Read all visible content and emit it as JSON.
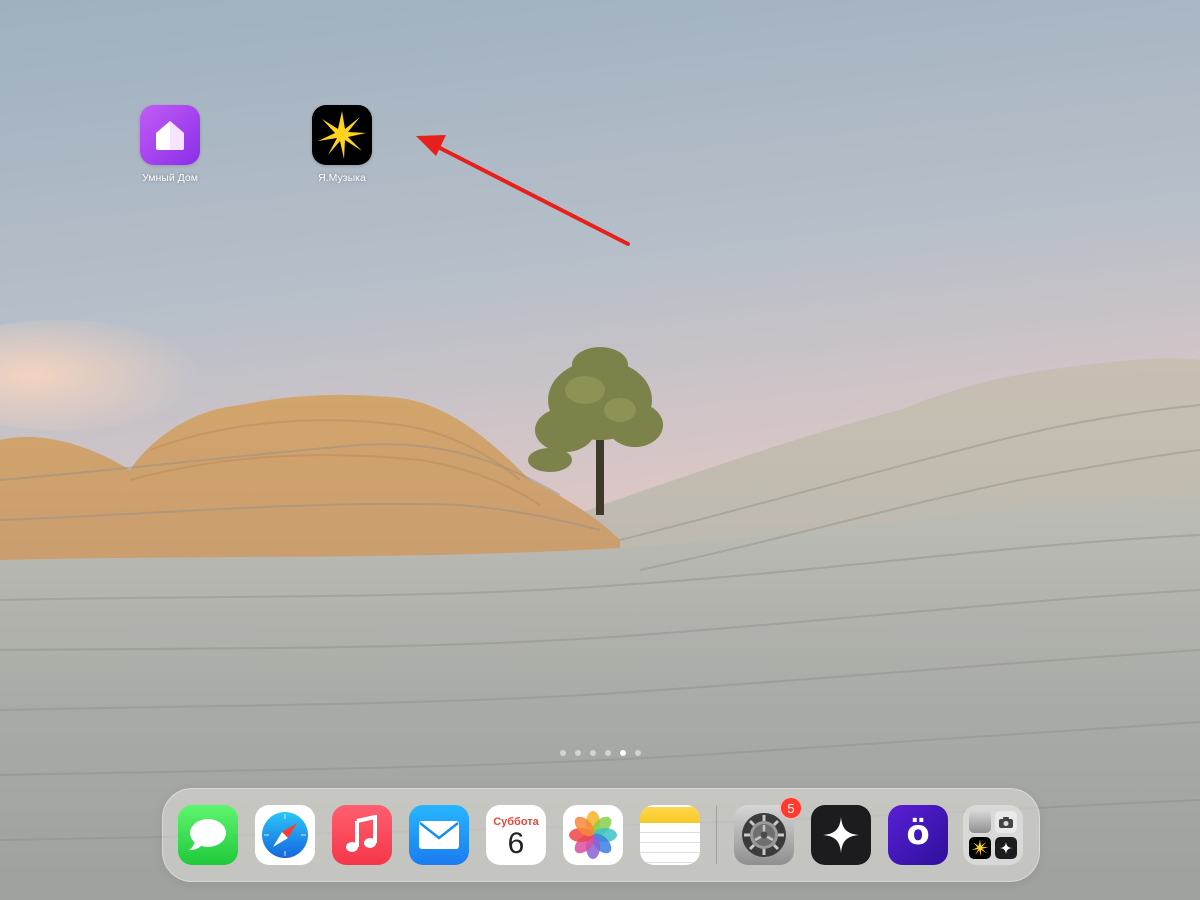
{
  "home_screen": {
    "apps": [
      {
        "label": "Умный Дом",
        "icon": "smart-home-icon",
        "color": "#a53ef0"
      },
      {
        "label": "Я.Музыка",
        "icon": "yandex-music-icon",
        "color": "#000000"
      }
    ]
  },
  "annotation": {
    "color": "#e8201c"
  },
  "page_indicator": {
    "pages": 6,
    "current": 5
  },
  "dock": {
    "apps": [
      {
        "name": "messages",
        "icon": "messages-icon"
      },
      {
        "name": "safari",
        "icon": "safari-icon"
      },
      {
        "name": "music",
        "icon": "music-icon"
      },
      {
        "name": "mail",
        "icon": "mail-icon"
      },
      {
        "name": "calendar",
        "icon": "calendar-icon",
        "day_label": "Суббота",
        "date": "6"
      },
      {
        "name": "photos",
        "icon": "photos-icon"
      },
      {
        "name": "notes",
        "icon": "notes-icon"
      },
      {
        "name": "settings",
        "icon": "settings-icon",
        "badge": "5"
      },
      {
        "name": "alice",
        "icon": "sparkle-icon"
      },
      {
        "name": "yandex-o",
        "icon": "o-umlaut-icon",
        "glyph": "ö"
      },
      {
        "name": "app-library",
        "icon": "app-library-icon"
      }
    ]
  }
}
